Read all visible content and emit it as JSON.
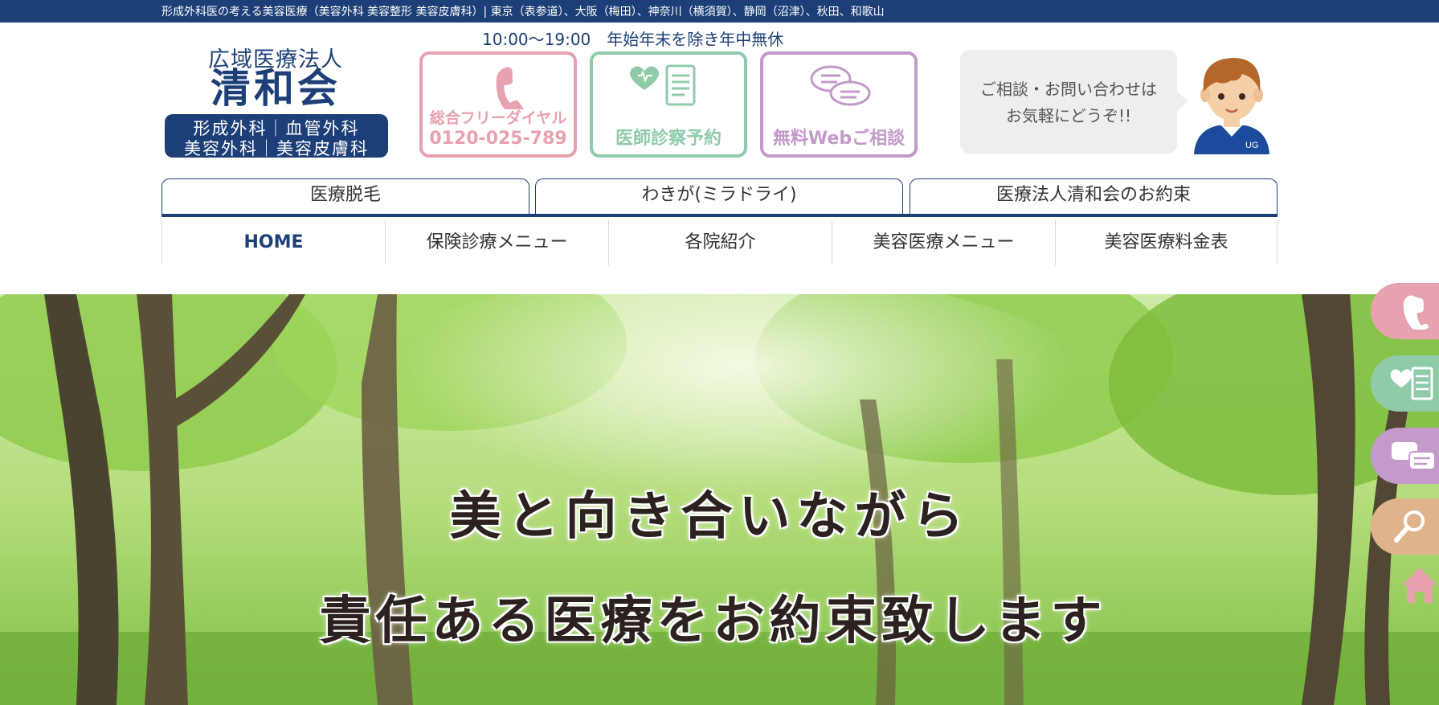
{
  "topbar": {
    "text": "形成外科医の考える美容医療（美容外科 美容整形 美容皮膚科）| 東京（表参道）、大阪（梅田）、神奈川（横須賀）、静岡（沼津）、秋田、和歌山"
  },
  "header": {
    "hours": "10:00〜19:00　年始年末を除き年中無休",
    "logo": {
      "line1": "広域医療法人",
      "line2": "清和会",
      "dept1": "形成外科｜血管外科",
      "dept2": "美容外科｜美容皮膚科"
    },
    "contact_buttons": [
      {
        "label": "総合フリーダイヤル",
        "phone": "0120-025-789",
        "icon": "phone-icon"
      },
      {
        "label": "医師診察予約",
        "icon": "medical-record-icon"
      },
      {
        "label": "無料Webご相談",
        "icon": "chat-bubbles-icon"
      }
    ],
    "bubble": {
      "line1": "ご相談・お問い合わせは",
      "line2": "お気軽にどうぞ!!"
    },
    "avatar_badge": "UG"
  },
  "tabs": [
    {
      "label": "医療脱毛"
    },
    {
      "label": "わきが(ミラドライ)"
    },
    {
      "label": "医療法人清和会のお約束"
    }
  ],
  "nav": [
    {
      "label": "HOME",
      "active": true
    },
    {
      "label": "保険診療メニュー"
    },
    {
      "label": "各院紹介"
    },
    {
      "label": "美容医療メニュー"
    },
    {
      "label": "美容医療料金表"
    }
  ],
  "hero": {
    "line1": "美と向き合いながら",
    "line2": "責任ある医療をお約束致します"
  },
  "floating_buttons": [
    {
      "icon": "phone-icon",
      "color": "#e8a1ae"
    },
    {
      "icon": "medical-record-icon",
      "color": "#8fcba9"
    },
    {
      "icon": "chat-bubbles-icon",
      "color": "#c39ac9"
    },
    {
      "icon": "search-icon",
      "color": "#dfb48d"
    },
    {
      "icon": "home-icon",
      "color": "#e8a1ae"
    }
  ],
  "colors": {
    "brand": "#1c3f77",
    "pink": "#e8a1ae",
    "green": "#8fcba9",
    "purple": "#c39ac9",
    "orange": "#dfb48d"
  }
}
